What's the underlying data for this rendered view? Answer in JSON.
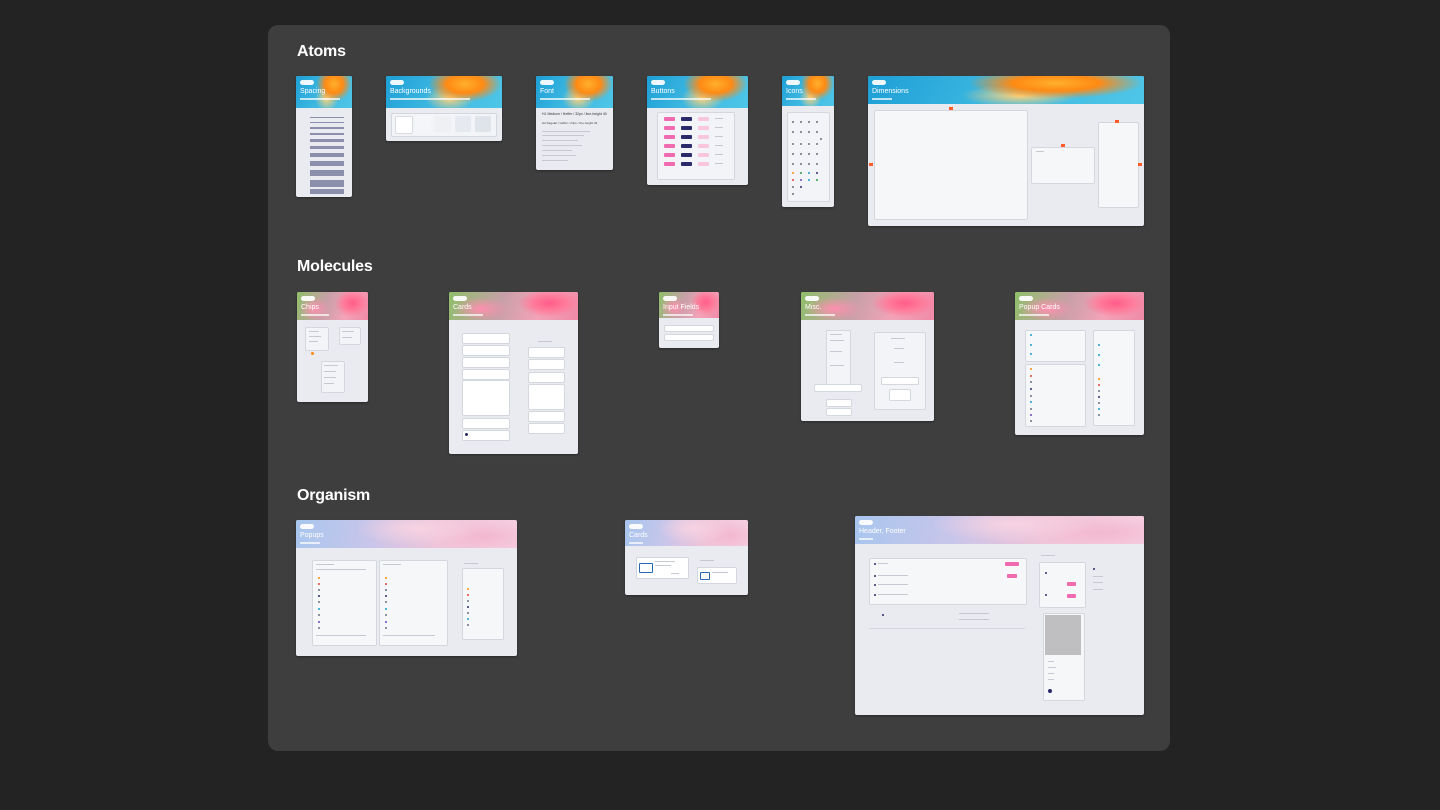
{
  "sections": {
    "atoms": "Atoms",
    "molecules": "Molecules",
    "organism": "Organism"
  },
  "frames": {
    "spacing": "Spacing",
    "backgrounds": "Backgrounds",
    "font": "Font",
    "buttons": "Buttons",
    "icons": "Icons",
    "dimensions": "Dimensions",
    "chips": "Chips",
    "cards": "Cards",
    "input_fields": "Input Fields",
    "misc": "Misc.",
    "popup_cards": "Popup Cards",
    "popups": "Popups",
    "org_cards": "Cards",
    "header_footer": "Header, Footer"
  },
  "font_samples": {
    "h1": "H1 Medium / Heffer / 32px / line-height 40",
    "h2": "H2 Regular / Heffer / 24px / line-height 32"
  },
  "colors": {
    "canvas": "#232323",
    "board": "#3e3e3e",
    "frame": "#e9ebf0",
    "pink": "#f06ab0",
    "navy": "#2b2a6b",
    "orange_marker": "#ff5a2b"
  }
}
